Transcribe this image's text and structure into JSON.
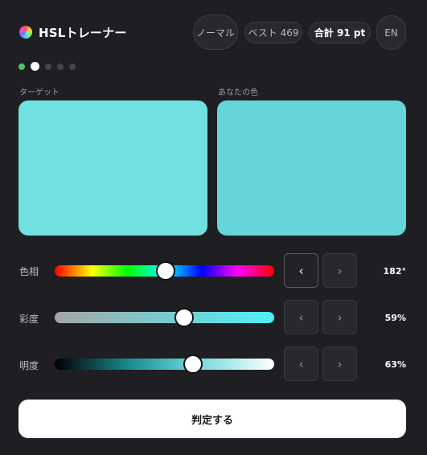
{
  "header": {
    "title": "HSLトレーナー",
    "logo_icon": "color-wheel-icon",
    "mode_label": "ノーマル",
    "best_label": "ベスト 469",
    "total_label": "合計 91 pt",
    "language_label": "EN"
  },
  "progress": {
    "total_rounds": 5,
    "completed_rounds": 1,
    "current_round": 2
  },
  "swatches": {
    "target_label": "ターゲット",
    "target_color": "#70e0e0",
    "yours_label": "あなたの色",
    "yours_color": "#66d5d9"
  },
  "sliders": [
    {
      "key": "hue",
      "label": "色相",
      "value_text": "182°",
      "value": 182,
      "max": 360
    },
    {
      "key": "saturation",
      "label": "彩度",
      "value_text": "59%",
      "value": 59,
      "max": 100
    },
    {
      "key": "lightness",
      "label": "明度",
      "value_text": "63%",
      "value": 63,
      "max": 100
    }
  ],
  "stepper": {
    "decrement_icon": "chevron-left-icon",
    "increment_icon": "chevron-right-icon",
    "decrement_glyph": "‹",
    "increment_glyph": "›"
  },
  "submit_label": "判定する",
  "colors": {
    "background": "#1f1e23",
    "accent_done": "#4cc46a"
  }
}
